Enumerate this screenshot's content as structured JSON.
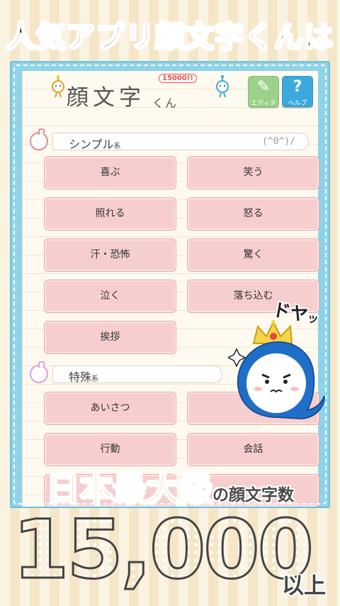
{
  "headline": {
    "dark_part": "人気アプリ",
    "accent_part": "顔文字くん",
    "tail": "は"
  },
  "app": {
    "logo": "顔文字",
    "logo_suffix": "くん",
    "logo_badge": "15000!!",
    "editor_label": "エディタ",
    "help_label": "ヘルプ",
    "help_glyph": "?"
  },
  "sections": [
    {
      "title": "シンプル",
      "title_suffix": "系",
      "sample_face": "(^0^)/",
      "items": [
        "喜ぶ",
        "笑う",
        "照れる",
        "怒る",
        "汗・恐怖",
        "驚く",
        "泣く",
        "落ち込む",
        "挨拶"
      ]
    },
    {
      "title": "特殊",
      "title_suffix": "系",
      "items": [
        "あいさつ",
        "",
        "行動",
        "会話"
      ]
    }
  ],
  "mascot": {
    "speech": "ドヤ",
    "speech_small": "ッ"
  },
  "promo": {
    "line1_big": "日本最大級",
    "line1_small": "の顔文字数",
    "number": "15,000",
    "suffix": "以上"
  },
  "colors": {
    "accent": "#ec7a32",
    "screen_frame": "#8fd3e8",
    "button_bg": "#f6cece",
    "number_fill": "#8ed184"
  }
}
